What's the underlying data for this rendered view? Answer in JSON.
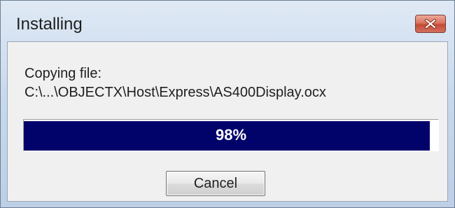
{
  "window": {
    "title": "Installing",
    "close_icon": "close-icon"
  },
  "status": {
    "line1": "Copying file:",
    "line2": "C:\\...\\OBJECTX\\Host\\Express\\AS400Display.ocx"
  },
  "progress": {
    "percent_text": "98%",
    "value": 98,
    "fill_color": "#02026b"
  },
  "buttons": {
    "cancel_label": "Cancel"
  }
}
